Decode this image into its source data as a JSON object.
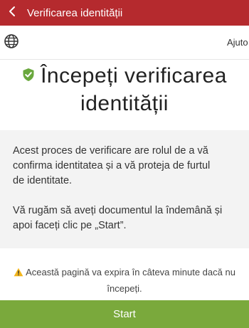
{
  "appbar": {
    "title": "Verificarea identității",
    "back_icon": "chevron-left-icon",
    "color": "#b52a2e"
  },
  "topbar": {
    "language_icon": "globe-icon",
    "help_label": "Ajuto"
  },
  "heading": {
    "icon": "shield-check-icon",
    "line1": "Începeți verificarea",
    "line2": "identității"
  },
  "info": {
    "paragraph1_line1": "Acest proces de verificare are rolul de a vă",
    "paragraph1_line2": "confirma identitatea și a vă proteja de furtul",
    "paragraph1_line3": "de identitate.",
    "paragraph2_line1": "Vă rugăm să aveți documentul la îndemână și",
    "paragraph2_line2": "apoi faceți clic pe „Start”."
  },
  "warning": {
    "icon": "warning-icon",
    "line1": "Această pagină va expira în câteva minute dacă nu",
    "line2": "începeți."
  },
  "start_button": {
    "label": "Start",
    "color": "#7aa93c"
  }
}
